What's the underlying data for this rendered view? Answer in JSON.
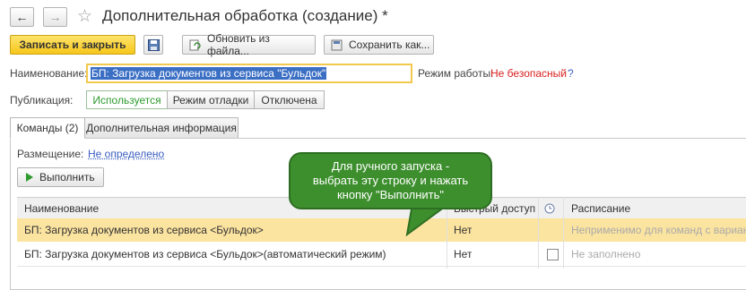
{
  "window": {
    "title": "Дополнительная обработка (создание) *",
    "back_glyph": "←",
    "forward_glyph": "→",
    "star_glyph": "☆"
  },
  "toolbar": {
    "save_close_label": "Записать и закрыть",
    "refresh_label": "Обновить из файла...",
    "save_as_label": "Сохранить как..."
  },
  "form": {
    "name_label": "Наименование:",
    "name_value": "БП: Загрузка документов из сервиса \"Бульдок\"",
    "mode_label": "Режим работы:",
    "mode_value": "Не безопасный",
    "mode_help": "?",
    "publish_label": "Публикация:",
    "publish_options": [
      "Используется",
      "Режим отладки",
      "Отключена"
    ]
  },
  "tabs": {
    "commands": "Команды (2)",
    "extra_info": "Дополнительная информация"
  },
  "commands": {
    "placement_label": "Размещение:",
    "placement_value": "Не определено",
    "run_label": "Выполнить",
    "columns": {
      "name": "Наименование",
      "quick": "Быстрый доступ",
      "schedule": "Расписание"
    },
    "rows": [
      {
        "name": "БП: Загрузка документов из сервиса <Бульдок>",
        "quick": "Нет",
        "schedule": "Неприменимо для команд с варианто"
      },
      {
        "name": "БП: Загрузка документов из сервиса <Бульдок>(автоматический режим)",
        "quick": "Нет",
        "schedule": "Не заполнено"
      }
    ]
  },
  "callout": {
    "line1": "Для ручного запуска -",
    "line2": "выбрать эту строку и нажать",
    "line3": "кнопку \"Выполнить\""
  },
  "colors": {
    "accent_yellow": "#f6c61b",
    "selected_row": "#fbe3a0",
    "callout_green": "#3d8f2e",
    "danger_red": "#d92020",
    "link_blue": "#3a5ec0"
  }
}
